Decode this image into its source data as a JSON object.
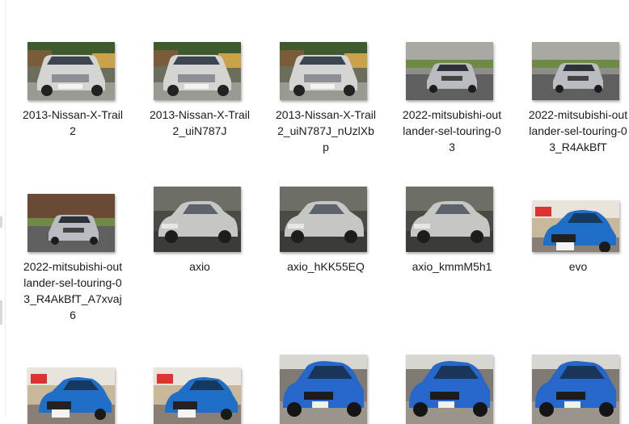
{
  "files": [
    {
      "name": "2013-Nissan-X-Trail2",
      "icon": "silver-suv-photo-thumbnail-icon"
    },
    {
      "name": "2013-Nissan-X-Trail2_uiN787J",
      "icon": "silver-suv-photo-thumbnail-icon"
    },
    {
      "name": "2013-Nissan-X-Trail2_uiN787J_nUzlXbp",
      "icon": "silver-suv-photo-thumbnail-icon"
    },
    {
      "name": "2022-mitsubishi-outlander-sel-touring-03",
      "icon": "outlander-photo-thumbnail-icon"
    },
    {
      "name": "2022-mitsubishi-outlander-sel-touring-03_R4AkBfT",
      "icon": "outlander-photo-thumbnail-icon"
    },
    {
      "name": "2022-mitsubishi-outlander-sel-touring-03_R4AkBfT_A7xvaj6",
      "icon": "outlander-photo-thumbnail-icon"
    },
    {
      "name": "axio",
      "icon": "silver-sedan-photo-thumbnail-icon"
    },
    {
      "name": "axio_hKK55EQ",
      "icon": "silver-sedan-photo-thumbnail-icon"
    },
    {
      "name": "axio_kmmM5h1",
      "icon": "silver-sedan-photo-thumbnail-icon"
    },
    {
      "name": "evo",
      "icon": "blue-car-photo-thumbnail-icon"
    },
    {
      "name": "",
      "icon": "blue-car-photo-thumbnail-icon"
    },
    {
      "name": "",
      "icon": "blue-car-photo-thumbnail-icon"
    },
    {
      "name": "",
      "icon": "blue-hatchback-photo-thumbnail-icon"
    },
    {
      "name": "",
      "icon": "blue-hatchback-photo-thumbnail-icon"
    },
    {
      "name": "",
      "icon": "blue-hatchback-photo-thumbnail-icon"
    }
  ],
  "colors": {
    "text": "#1b1b1b",
    "background": "#ffffff",
    "silver": "#c8c8c6",
    "blue": "#1f6fc9"
  }
}
